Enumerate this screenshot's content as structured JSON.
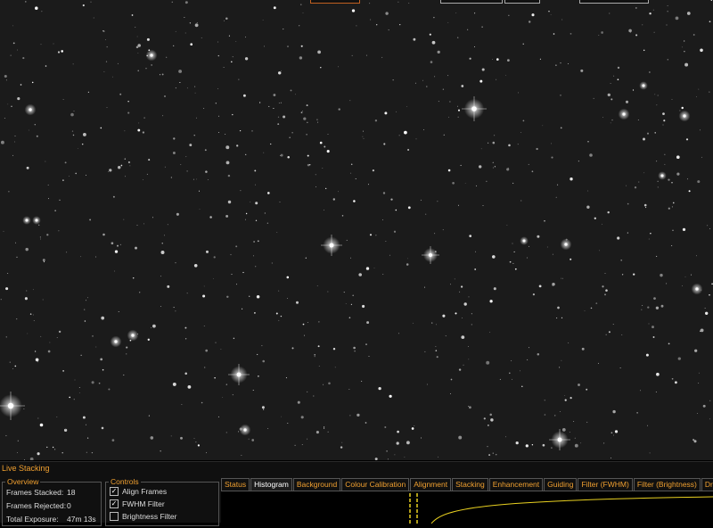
{
  "panel_title": "Live Stacking",
  "overview": {
    "title": "Overview",
    "rows": [
      {
        "label": "Frames Stacked:",
        "value": "18"
      },
      {
        "label": "Frames Rejected:",
        "value": "0"
      },
      {
        "label": "Total Exposure:",
        "value": "47m 13s"
      }
    ]
  },
  "controls": {
    "title": "Controls",
    "items": [
      {
        "label": "Align Frames",
        "checked": true
      },
      {
        "label": "FWHM Filter",
        "checked": true
      },
      {
        "label": "Brightness Filter",
        "checked": false
      }
    ]
  },
  "tabs": [
    "Status",
    "Histogram",
    "Background",
    "Colour Calibration",
    "Alignment",
    "Stacking",
    "Enhancement",
    "Guiding",
    "Filter (FWHM)",
    "Filter (Brightness)",
    "Drift"
  ],
  "active_tab": "Histogram",
  "colors": {
    "accent": "#f0a030",
    "histogram_curve": "#e8d020"
  }
}
